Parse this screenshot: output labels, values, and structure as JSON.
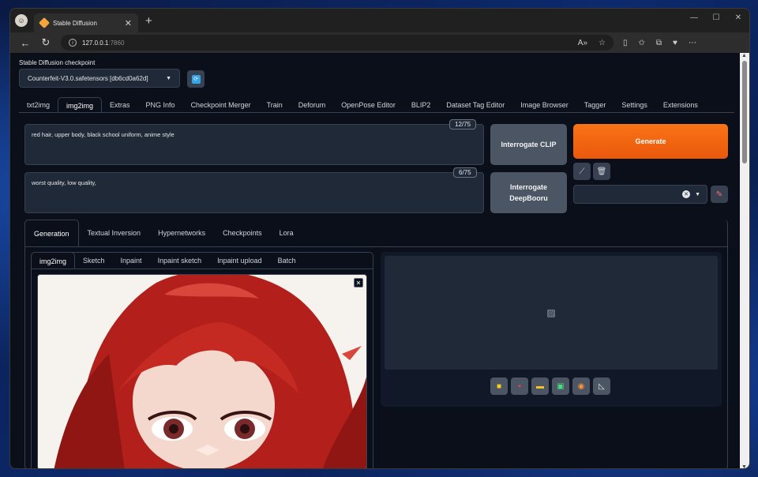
{
  "browser": {
    "tab_title": "Stable Diffusion",
    "url_host": "127.0.0.1",
    "url_port": ":7860"
  },
  "checkpoint": {
    "label": "Stable Diffusion checkpoint",
    "value": "Counterfeit-V3.0.safetensors [db6cd0a62d]"
  },
  "main_tabs": [
    "txt2img",
    "img2img",
    "Extras",
    "PNG Info",
    "Checkpoint Merger",
    "Train",
    "Deforum",
    "OpenPose Editor",
    "BLIP2",
    "Dataset Tag Editor",
    "Image Browser",
    "Tagger",
    "Settings",
    "Extensions"
  ],
  "prompt": {
    "positive": "red hair, upper body, black school uniform, anime style",
    "positive_tokens": "12/75",
    "negative": "worst quality, low quality,",
    "negative_tokens": "6/75"
  },
  "buttons": {
    "interrogate_clip": "Interrogate CLIP",
    "interrogate_deepbooru": "Interrogate DeepBooru",
    "generate": "Generate"
  },
  "sub_tabs": [
    "Generation",
    "Textual Inversion",
    "Hypernetworks",
    "Checkpoints",
    "Lora"
  ],
  "img_tabs": [
    "img2img",
    "Sketch",
    "Inpaint",
    "Inpaint sketch",
    "Inpaint upload",
    "Batch"
  ],
  "colors": {
    "accent": "#ea580c",
    "background": "#0b0f19",
    "panel": "#1f2937"
  }
}
